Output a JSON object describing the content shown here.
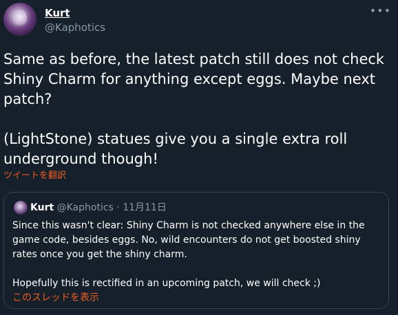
{
  "author": {
    "name": "Kurt",
    "handle": "@Kaphotics"
  },
  "more_label": "•••",
  "tweet": {
    "paragraph1": "Same as before, the latest patch still does not check Shiny Charm for anything except eggs. Maybe next patch?",
    "paragraph2": "(LightStone) statues give you a single extra roll underground though!",
    "translate_label": "ツイートを翻訳"
  },
  "quote": {
    "name": "Kurt",
    "handle": "@Kaphotics",
    "separator": "·",
    "date": "11月11日",
    "paragraph1": "Since this wasn't clear: Shiny Charm is not checked anywhere else in the game code, besides eggs. No, wild encounters do not get boosted shiny rates once you get the shiny charm.",
    "paragraph2": "Hopefully this is rectified in an upcoming patch, we will check ;)",
    "thread_label": "このスレッドを表示"
  },
  "colors": {
    "background": "#15202b",
    "text": "#ffffff",
    "secondary": "#8899a6",
    "accent": "#f45d22",
    "border": "#38444d"
  }
}
